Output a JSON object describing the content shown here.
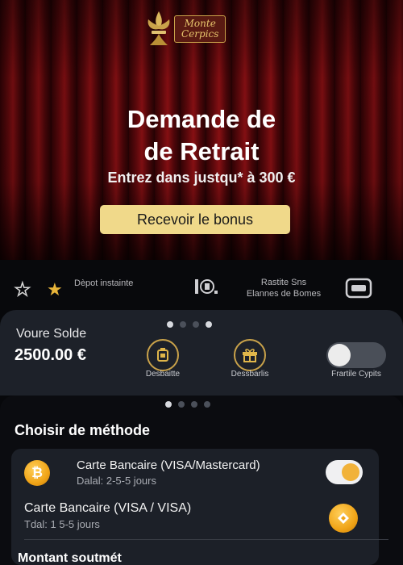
{
  "brand": {
    "logo_text_line1": "Monte",
    "logo_text_line2": "Cerpics"
  },
  "hero": {
    "title_line1": "Demande de",
    "title_line2": "de Retrait",
    "subtitle": "Entrez dans justqu* à 300 €",
    "bonus_button": "Recevoir le bonus"
  },
  "features": {
    "deposit_label": "Dèpot instainte",
    "rapid_label_line1": "Rastite Sns",
    "rapid_label_line2": "Elannes de Bomes"
  },
  "balance": {
    "label": "Voure Solde",
    "amount": "2500.00 €",
    "actions": [
      {
        "label": "Desbaitte",
        "icon": "bonus-badge-icon"
      },
      {
        "label": "Dessbarlis",
        "icon": "gift-icon"
      }
    ],
    "toggle_label": "Frartile Cypits",
    "toggle_on": false
  },
  "methods": {
    "section_title": "Choisir de méthode",
    "items": [
      {
        "title": "Carte Bancaire (VISA/Mastercard)",
        "delay": "Dalal: 2-5-5 jours",
        "icon": "bitcoin-icon",
        "coin_symbol": "₿"
      },
      {
        "title": "Carte Bancaire (VISA / VISA)",
        "delay": "Tdal: 1 5-5 jours",
        "icon": "card-coin-icon"
      }
    ]
  },
  "amount_label": "Montant soutmét",
  "colors": {
    "accent_gold": "#c9a24a",
    "button_gold": "#f0d98a",
    "coin_orange": "#f0a417",
    "card_bg": "#1c2028"
  }
}
